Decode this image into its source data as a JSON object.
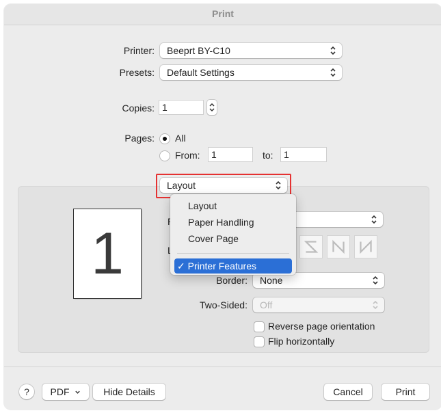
{
  "window": {
    "title": "Print"
  },
  "printer": {
    "label": "Printer:",
    "value": "Beeprt BY-C10"
  },
  "presets": {
    "label": "Presets:",
    "value": "Default Settings"
  },
  "copies": {
    "label": "Copies:",
    "value": "1"
  },
  "pages": {
    "label": "Pages:",
    "all_label": "All",
    "from_label": "From:",
    "from_value": "1",
    "to_label": "to:",
    "to_value": "1",
    "selected": "All"
  },
  "section_popup": {
    "value": "Layout"
  },
  "section_menu": {
    "items": [
      "Layout",
      "Paper Handling",
      "Cover Page"
    ],
    "selected": "Printer Features",
    "checkmark": "✓"
  },
  "preview": {
    "page_number": "1"
  },
  "layout": {
    "obscured_label_1": "P",
    "obscured_label_2": "L",
    "layout_direction_icons": [
      "Z-order-icon",
      "reverse-S-order-icon",
      "N-order-icon",
      "reverse-N-order-icon"
    ],
    "border": {
      "label": "Border:",
      "value": "None"
    },
    "two_sided": {
      "label": "Two-Sided:",
      "value": "Off"
    },
    "reverse_orientation_label": "Reverse page orientation",
    "flip_horizontally_label": "Flip horizontally"
  },
  "footer": {
    "help_label": "?",
    "pdf_label": "PDF",
    "hide_details_label": "Hide Details",
    "cancel_label": "Cancel",
    "print_label": "Print"
  },
  "colors": {
    "accent": "#2b6fd6",
    "highlight_box": "#e53232"
  }
}
